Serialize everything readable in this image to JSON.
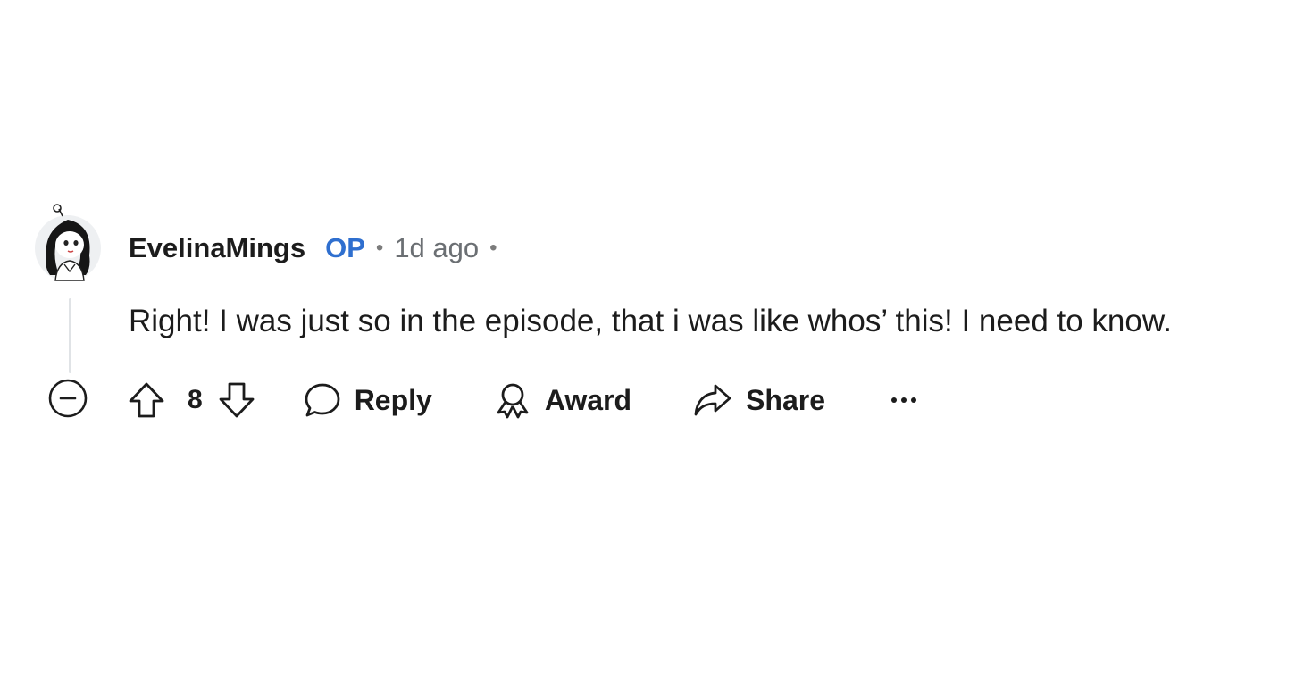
{
  "comment": {
    "username": "EvelinaMings",
    "op_badge": "OP",
    "separator": "•",
    "time": "1d ago",
    "body": "Right! I was just so in the episode, that i was like whos’ this! I need to know.",
    "score": "8"
  },
  "actions": {
    "reply_label": "Reply",
    "award_label": "Award",
    "share_label": "Share"
  },
  "icons": {
    "avatar": "avatar-icon",
    "collapse": "collapse-minus-icon",
    "upvote": "arrow-up-icon",
    "downvote": "arrow-down-icon",
    "reply": "speech-bubble-icon",
    "award": "award-ribbon-icon",
    "share": "share-arrow-icon",
    "more": "ellipsis-icon"
  },
  "colors": {
    "op": "#2f6fcf",
    "text": "#1c1c1c",
    "muted": "#6b6f73",
    "thread_line": "#e0e3e6"
  }
}
